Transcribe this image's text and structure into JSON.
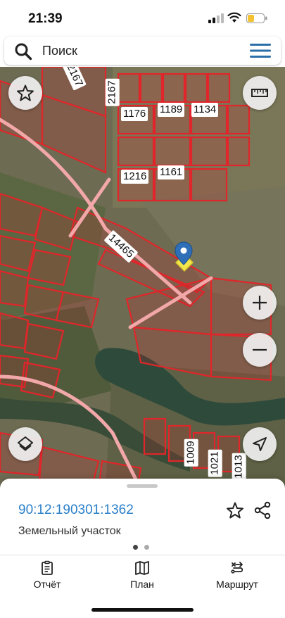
{
  "status_bar": {
    "time": "21:39"
  },
  "search": {
    "placeholder": "Поиск"
  },
  "map": {
    "parcel_labels": [
      "2167",
      "2167",
      "1176",
      "1189",
      "1134",
      "1216",
      "1161",
      "14465",
      "1009",
      "1021",
      "1013"
    ],
    "colors": {
      "parcel_border": "#e0262a",
      "marker": "#2f6fb8",
      "selected": "#f2e64a"
    }
  },
  "parcel": {
    "cadastral_number": "90:12:190301:1362",
    "type": "Земельный участок"
  },
  "tabs": [
    {
      "label": "Отчёт",
      "icon": "report-icon"
    },
    {
      "label": "План",
      "icon": "map-plan-icon"
    },
    {
      "label": "Маршрут",
      "icon": "route-icon"
    }
  ]
}
